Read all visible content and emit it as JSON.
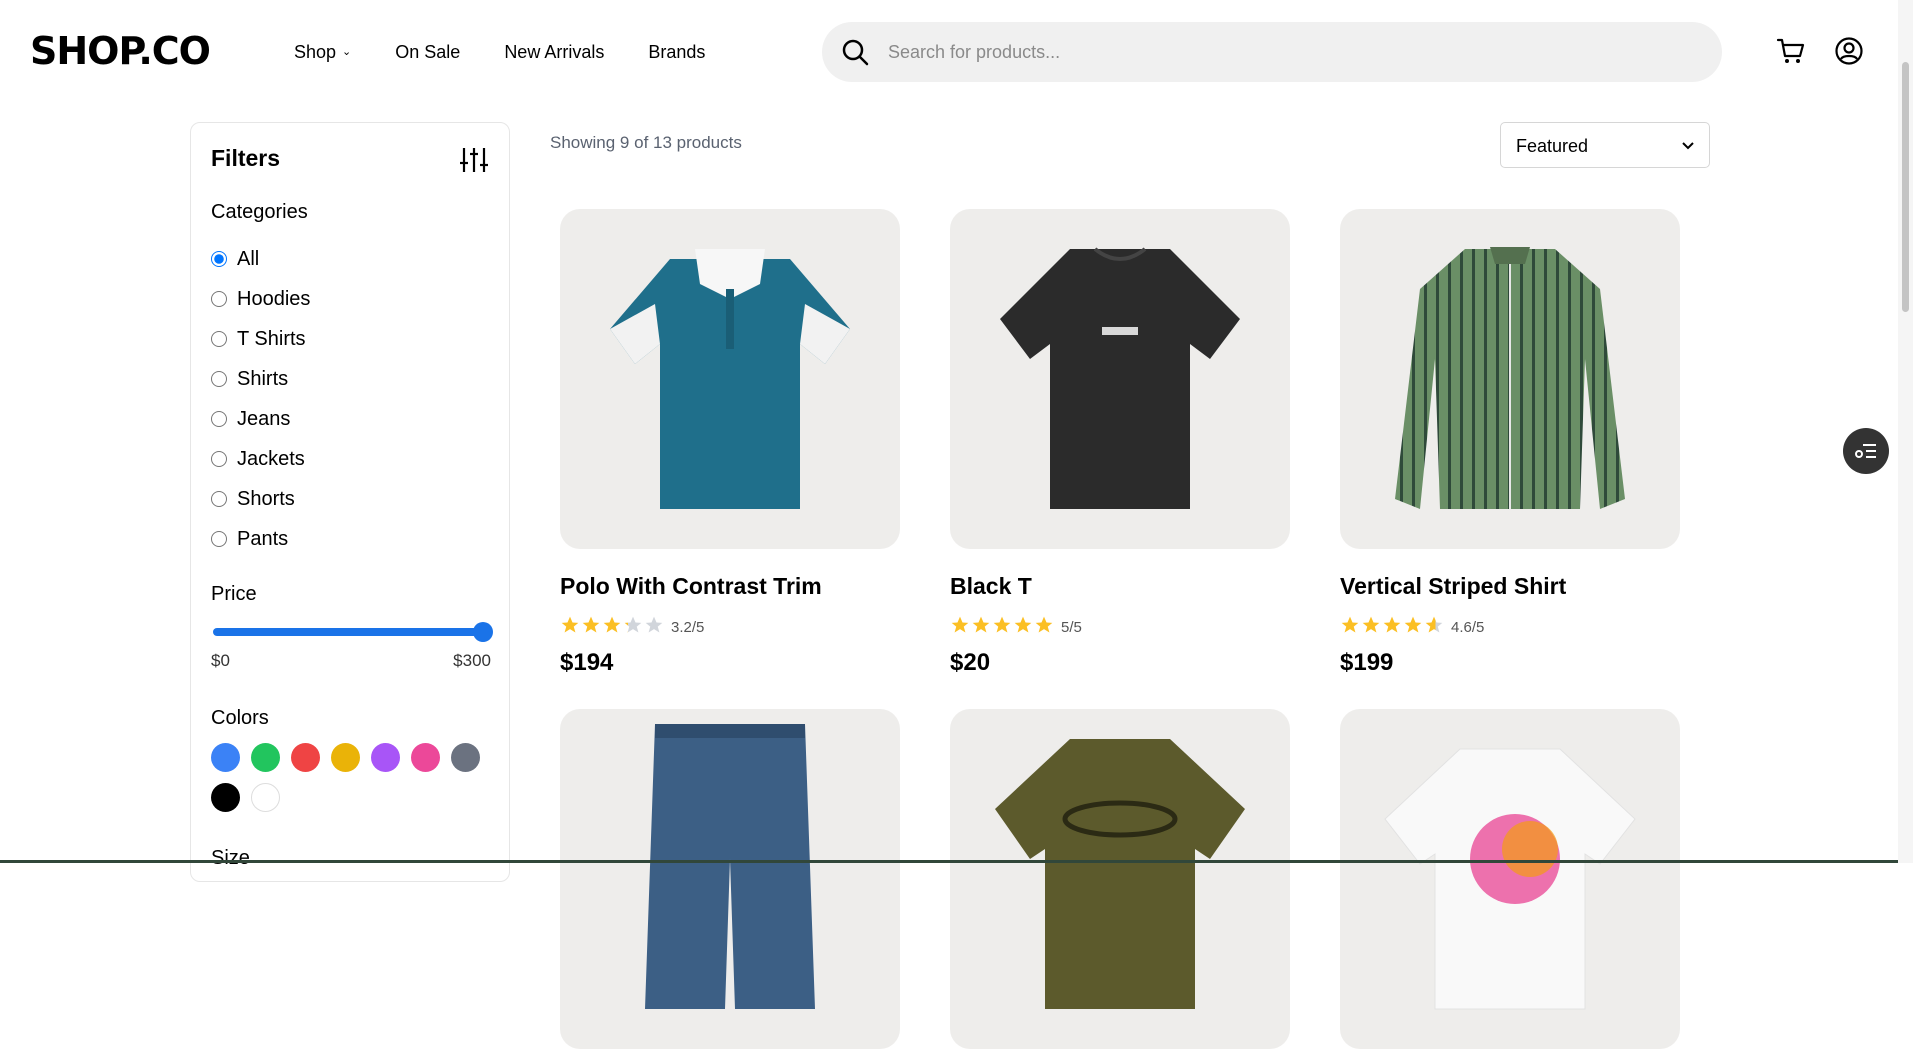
{
  "header": {
    "logo": "SHOP.CO",
    "nav": [
      "Shop",
      "On Sale",
      "New Arrivals",
      "Brands"
    ],
    "search_placeholder": "Search for products...",
    "icons": [
      "search-icon",
      "cart-icon",
      "user-icon"
    ]
  },
  "filters": {
    "title": "Filters",
    "categories_title": "Categories",
    "categories": [
      "All",
      "Hoodies",
      "T Shirts",
      "Shirts",
      "Jeans",
      "Jackets",
      "Shorts",
      "Pants"
    ],
    "selected_category": "All",
    "price_title": "Price",
    "price_min_label": "$0",
    "price_max_label": "$300",
    "price_value": [
      0,
      300
    ],
    "colors_title": "Colors",
    "colors": [
      "#3b82f6",
      "#22c55e",
      "#ef4444",
      "#eab308",
      "#a855f7",
      "#ec4899",
      "#6b7280",
      "#000000",
      "#ffffff"
    ],
    "size_title": "Size"
  },
  "main": {
    "showing": "Showing 9 of 13 products",
    "sort": "Featured"
  },
  "products": [
    {
      "name": "Polo With Contrast Trim",
      "rating": 3.2,
      "rating_label": "3.2/5",
      "price": "$194",
      "image_color": "#1f6f8b"
    },
    {
      "name": "Black T",
      "rating": 5,
      "rating_label": "5/5",
      "price": "$20",
      "image_color": "#2b2b2b"
    },
    {
      "name": "Vertical Striped Shirt",
      "rating": 4.6,
      "rating_label": "4.6/5",
      "price": "$199",
      "image_color": "#6a8f66"
    },
    {
      "name": "",
      "image_color": "#3c5f85"
    },
    {
      "name": "",
      "image_color": "#5c5a2c"
    },
    {
      "name": "",
      "image_color": "#f4f4f4"
    }
  ],
  "colors": {
    "accent": "#1a73e8",
    "star": "#fbbf24",
    "star_empty": "#d1d5db"
  }
}
